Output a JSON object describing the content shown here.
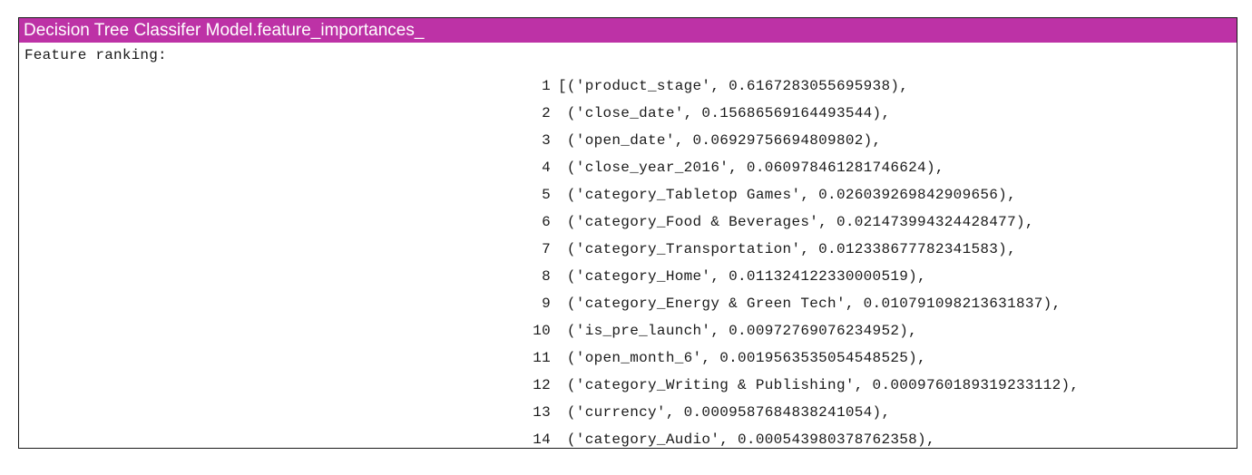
{
  "panel": {
    "title": "Decision Tree Classifer Model.feature_importances_",
    "heading": "Feature ranking:",
    "rows": [
      {
        "num": "1",
        "text": "[('product_stage', 0.6167283055695938),"
      },
      {
        "num": "2",
        "text": " ('close_date', 0.15686569164493544),"
      },
      {
        "num": "3",
        "text": " ('open_date', 0.06929756694809802),"
      },
      {
        "num": "4",
        "text": " ('close_year_2016', 0.060978461281746624),"
      },
      {
        "num": "5",
        "text": " ('category_Tabletop Games', 0.026039269842909656),"
      },
      {
        "num": "6",
        "text": " ('category_Food & Beverages', 0.021473994324428477),"
      },
      {
        "num": "7",
        "text": " ('category_Transportation', 0.012338677782341583),"
      },
      {
        "num": "8",
        "text": " ('category_Home', 0.011324122330000519),"
      },
      {
        "num": "9",
        "text": " ('category_Energy & Green Tech', 0.010791098213631837),"
      },
      {
        "num": "10",
        "text": " ('is_pre_launch', 0.00972769076234952),"
      },
      {
        "num": "11",
        "text": " ('open_month_6', 0.0019563535054548525),"
      },
      {
        "num": "12",
        "text": " ('category_Writing & Publishing', 0.0009760189319233112),"
      },
      {
        "num": "13",
        "text": " ('currency', 0.0009587684838241054),"
      },
      {
        "num": "14",
        "text": " ('category_Audio', 0.000543980378762358),"
      }
    ]
  },
  "colors": {
    "title_bar": "#bd32a6",
    "title_text": "#ffffff",
    "border": "#1a1a1a"
  }
}
